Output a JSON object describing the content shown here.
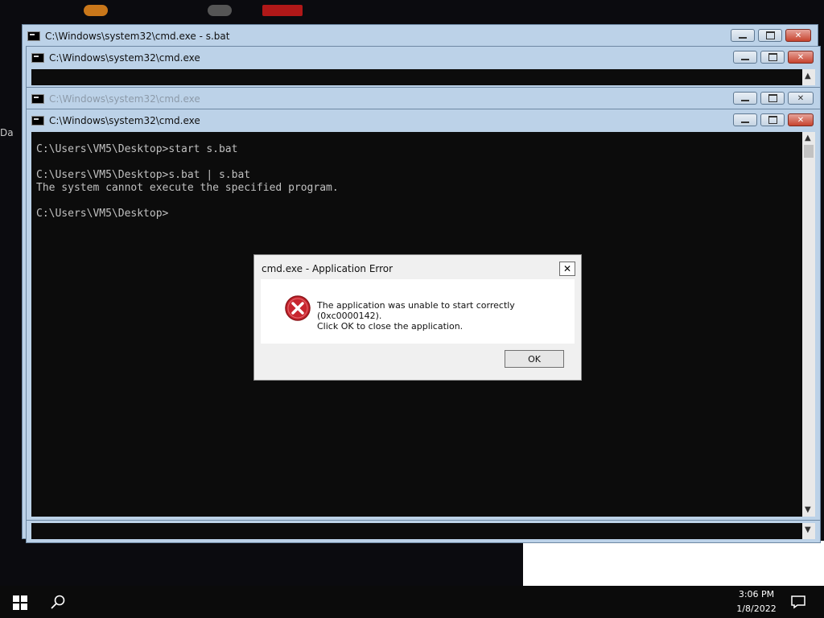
{
  "desktop": {
    "edge_label": "Da"
  },
  "windows": {
    "back": {
      "title": "C:\\Windows\\system32\\cmd.exe - s.bat"
    },
    "second": {
      "title": "C:\\Windows\\system32\\cmd.exe"
    },
    "third": {
      "title": "C:\\Windows\\system32\\cmd.exe"
    },
    "front": {
      "title": "C:\\Windows\\system32\\cmd.exe"
    }
  },
  "terminal": {
    "lines": [
      "C:\\Users\\VM5\\Desktop>start s.bat",
      "C:\\Users\\VM5\\Desktop>s.bat | s.bat",
      "The system cannot execute the specified program.",
      "C:\\Users\\VM5\\Desktop>"
    ]
  },
  "dialog": {
    "title": "cmd.exe - Application Error",
    "message_line1": "The application was unable to start correctly (0xc0000142).",
    "message_line2": "Click OK to close the application.",
    "ok_label": "OK",
    "close_glyph": "✕",
    "icon": "error-icon"
  },
  "taskbar": {
    "time": "3:06 PM",
    "date": "1/8/2022",
    "start_icon": "windows-logo-icon",
    "search_icon": "search-icon",
    "notification_icon": "notification-icon"
  },
  "colors": {
    "console_bg": "#0c0c0c",
    "console_text": "#c0c0c0",
    "titlebar": "#bcd2e8",
    "close_red": "#c7442f",
    "error_red": "#c8262f"
  }
}
